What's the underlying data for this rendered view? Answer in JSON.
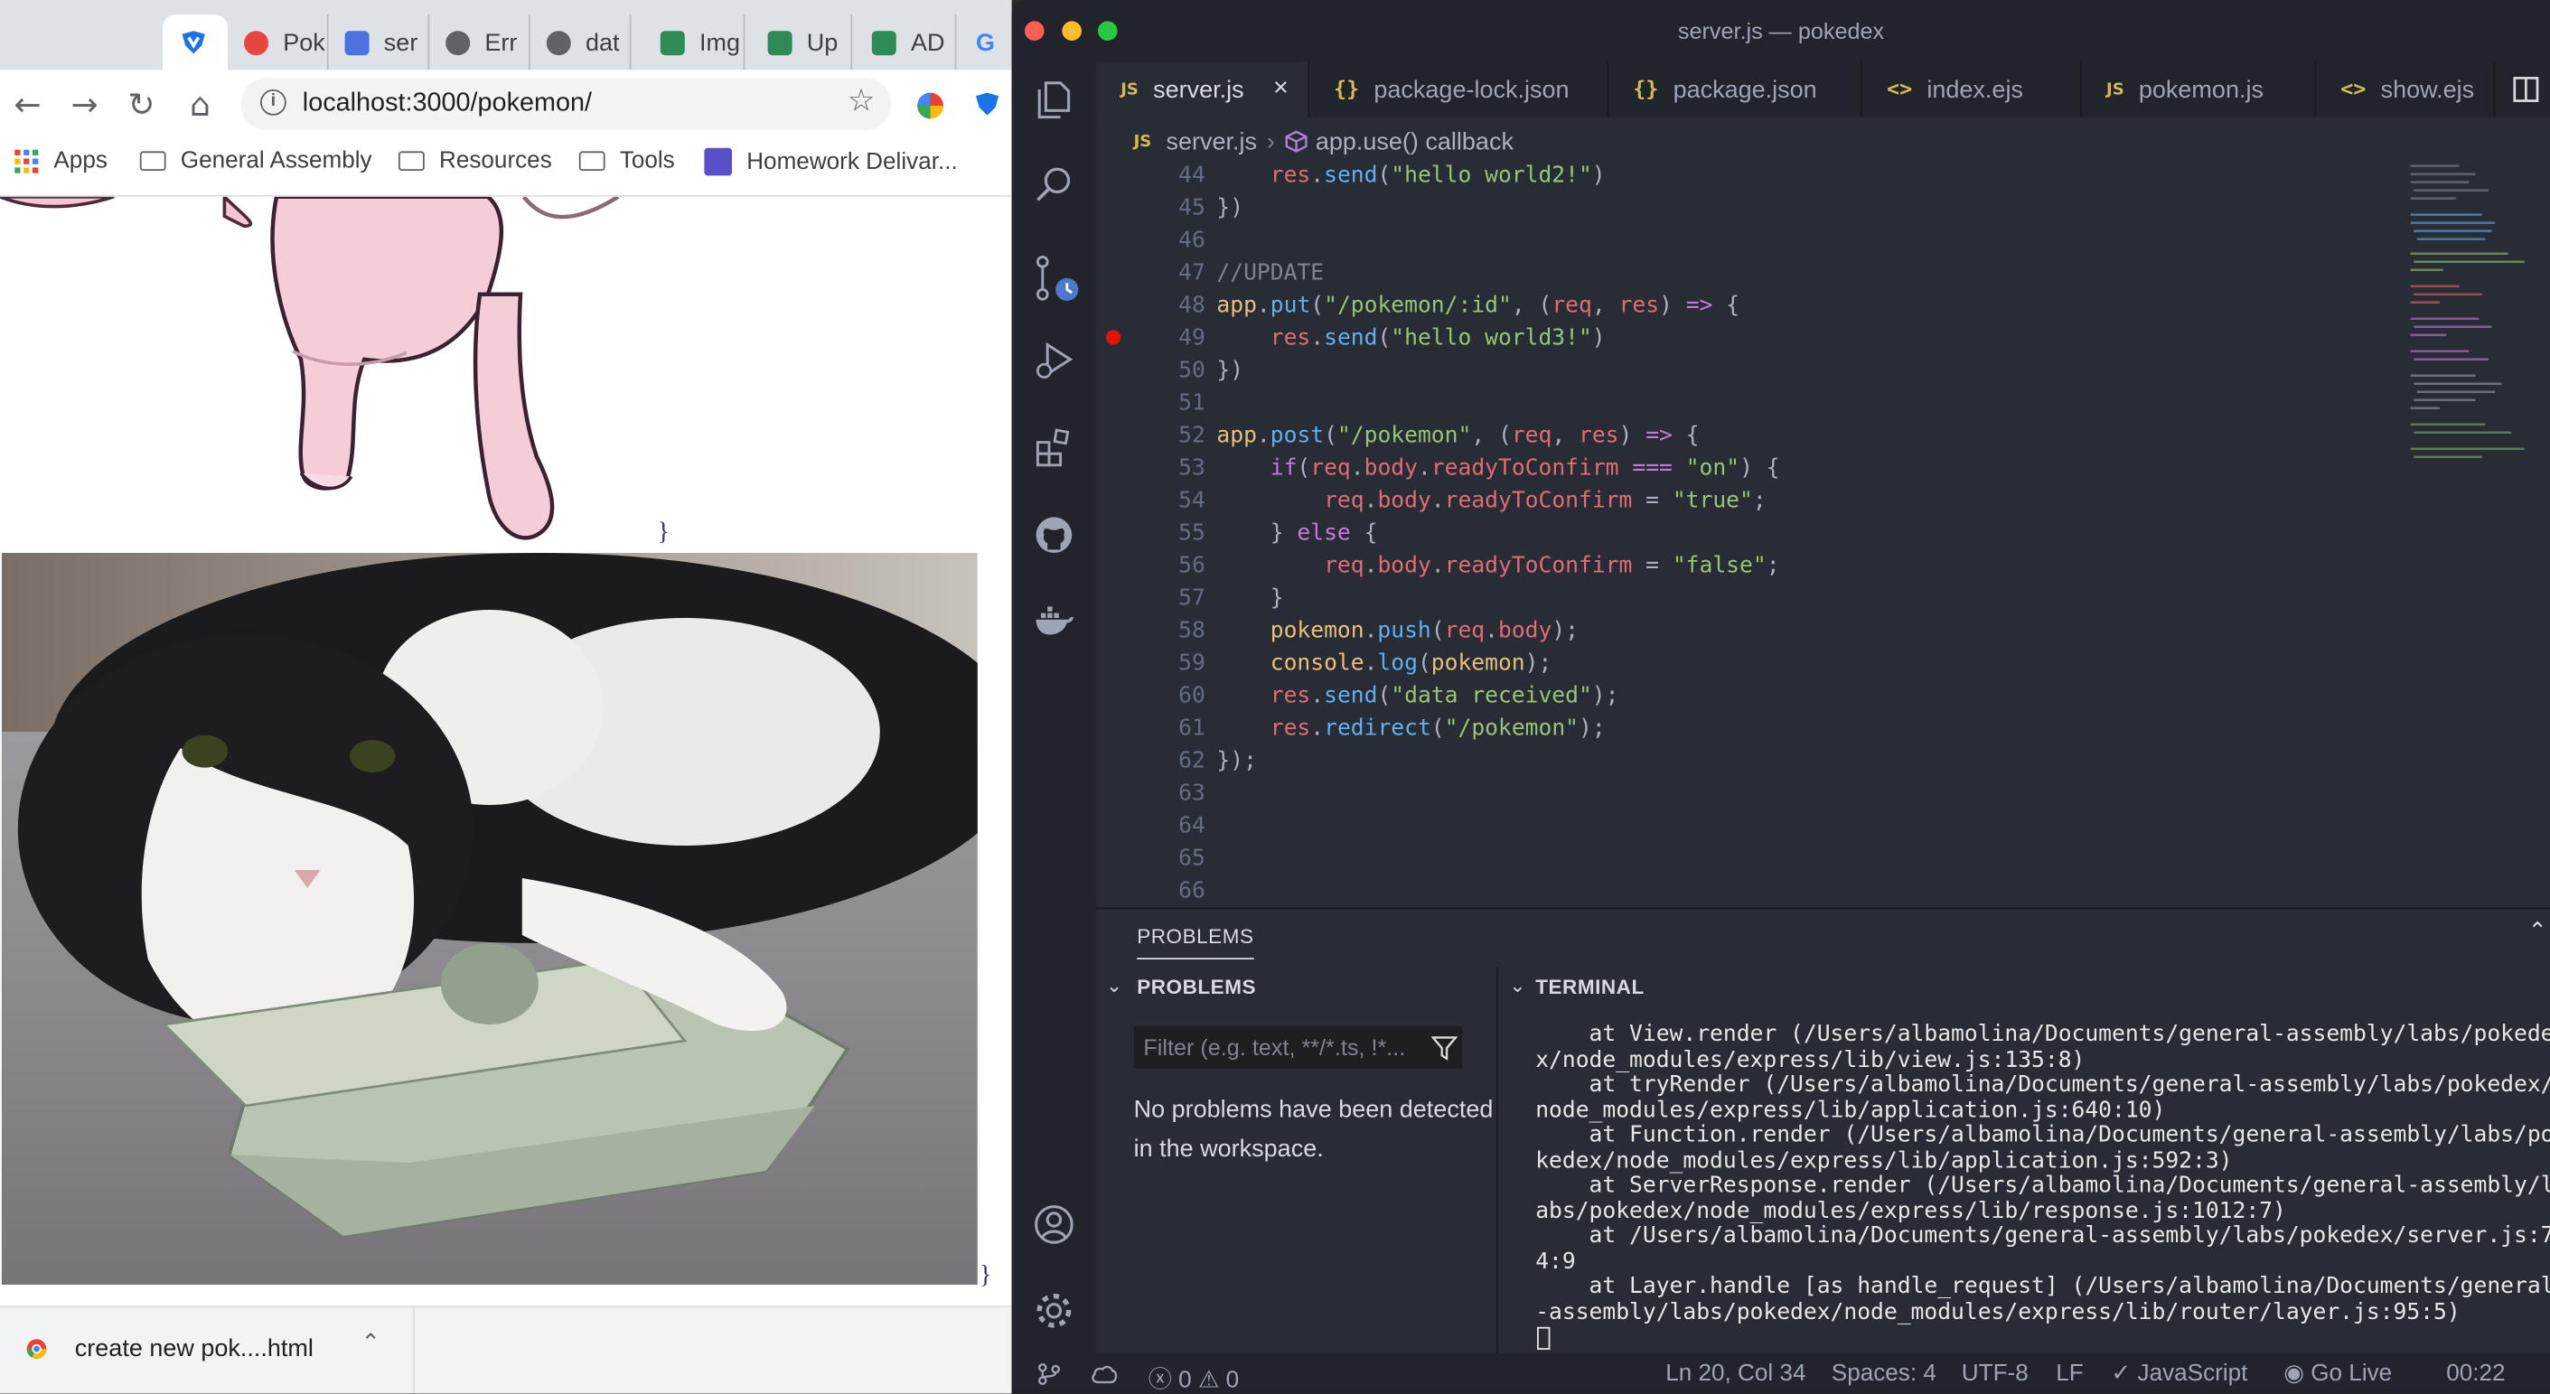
{
  "browser": {
    "tabs": [
      {
        "label": ""
      },
      {
        "label": "Pok"
      },
      {
        "label": "ser"
      },
      {
        "label": "Err"
      },
      {
        "label": "dat"
      },
      {
        "label": "Img"
      },
      {
        "label": "Up"
      },
      {
        "label": "AD"
      },
      {
        "label": "G"
      }
    ],
    "url": "localhost:3000/pokemon/",
    "bookmarks": [
      "Apps",
      "General Assembly",
      "Resources",
      "Tools",
      "Homework Delivar..."
    ],
    "brace_top": "}",
    "brace_bottom": "}",
    "download_item": "create new pok....html"
  },
  "vscode": {
    "window_title": "server.js — pokedex",
    "tabs": [
      {
        "badge": "JS",
        "label": "server.js"
      },
      {
        "badge": "{}",
        "label": "package-lock.json"
      },
      {
        "badge": "{}",
        "label": "package.json"
      },
      {
        "badge": "<>",
        "label": "index.ejs"
      },
      {
        "badge": "JS",
        "label": "pokemon.js"
      },
      {
        "badge": "<>",
        "label": "show.ejs"
      }
    ],
    "breadcrumb": {
      "file_badge": "JS",
      "file": "server.js",
      "symbol": "app.use() callback"
    },
    "code_lines": [
      {
        "n": "44",
        "t": "    res.send(\"hello world2!\")"
      },
      {
        "n": "45",
        "t": "})"
      },
      {
        "n": "46",
        "t": ""
      },
      {
        "n": "47",
        "t": "//UPDATE"
      },
      {
        "n": "48",
        "t": "app.put(\"/pokemon/:id\", (req, res) => {"
      },
      {
        "n": "49",
        "t": "    res.send(\"hello world3!\")"
      },
      {
        "n": "50",
        "t": "})"
      },
      {
        "n": "51",
        "t": ""
      },
      {
        "n": "52",
        "t": "app.post(\"/pokemon\", (req, res) => {"
      },
      {
        "n": "53",
        "t": "    if(req.body.readyToConfirm === \"on\") {"
      },
      {
        "n": "54",
        "t": "        req.body.readyToConfirm = \"true\";"
      },
      {
        "n": "55",
        "t": "    } else {"
      },
      {
        "n": "56",
        "t": "        req.body.readyToConfirm = \"false\";"
      },
      {
        "n": "57",
        "t": "    }"
      },
      {
        "n": "58",
        "t": "    pokemon.push(req.body);"
      },
      {
        "n": "59",
        "t": "    console.log(pokemon);"
      },
      {
        "n": "60",
        "t": "    res.send(\"data received\");"
      },
      {
        "n": "61",
        "t": "    res.redirect(\"/pokemon\");"
      },
      {
        "n": "62",
        "t": "});"
      },
      {
        "n": "63",
        "t": ""
      },
      {
        "n": "64",
        "t": ""
      },
      {
        "n": "65",
        "t": ""
      },
      {
        "n": "66",
        "t": ""
      }
    ],
    "panel": {
      "title": "PROBLEMS",
      "problems_header": "PROBLEMS",
      "terminal_header": "TERMINAL",
      "filter_placeholder": "Filter (e.g. text, **/*.ts, !*...",
      "no_problems": "No problems have been detected in the workspace.",
      "terminal_lines": [
        "    at View.render (/Users/albamolina/Documents/general-assembly/labs/pokede",
        "x/node_modules/express/lib/view.js:135:8)",
        "    at tryRender (/Users/albamolina/Documents/general-assembly/labs/pokedex/",
        "node_modules/express/lib/application.js:640:10)",
        "    at Function.render (/Users/albamolina/Documents/general-assembly/labs/po",
        "kedex/node_modules/express/lib/application.js:592:3)",
        "    at ServerResponse.render (/Users/albamolina/Documents/general-assembly/l",
        "abs/pokedex/node_modules/express/lib/response.js:1012:7)",
        "    at /Users/albamolina/Documents/general-assembly/labs/pokedex/server.js:7",
        "4:9",
        "    at Layer.handle [as handle_request] (/Users/albamolina/Documents/general",
        "-assembly/labs/pokedex/node_modules/express/lib/router/layer.js:95:5)"
      ]
    },
    "status": {
      "errors": "0",
      "warnings": "0",
      "cursor": "Ln 20, Col 34",
      "spaces": "Spaces: 4",
      "encoding": "UTF-8",
      "eol": "LF",
      "language": "JavaScript",
      "golive": "Go Live",
      "time": "00:22"
    }
  }
}
